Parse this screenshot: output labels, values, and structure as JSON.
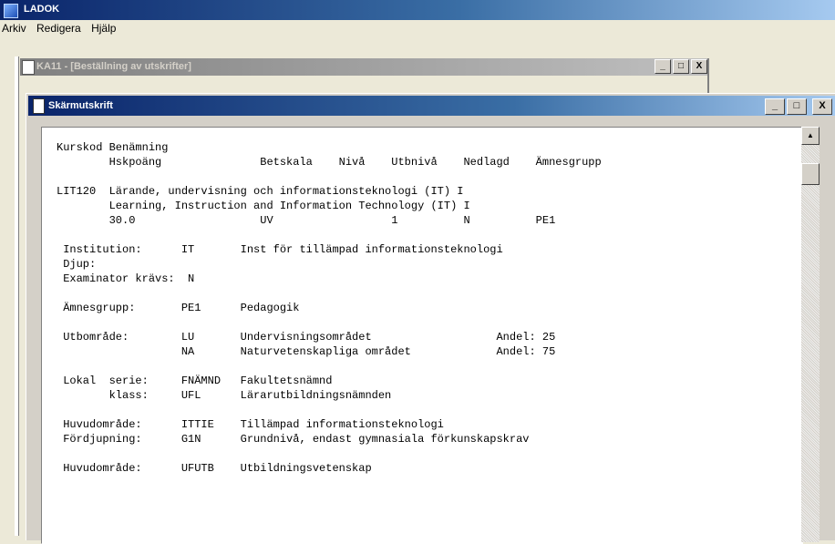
{
  "app": {
    "title": "LADOK"
  },
  "menu": [
    "Arkiv",
    "Redigera",
    "Hjälp"
  ],
  "background_window": {
    "title": "KA11 - [Beställning av utskrifter]"
  },
  "window": {
    "title": "Skärmutskrift",
    "controls": {
      "minimize": "_",
      "maximize": "□",
      "close": "X"
    }
  },
  "scrollbar": {
    "up_arrow": "▲"
  },
  "printout": {
    "lines": [
      "Kurskod Benämning",
      "        Hskpoäng               Betskala    Nivå    Utbnivå    Nedlagd    Ämnesgrupp",
      "",
      "LIT120  Lärande, undervisning och informationsteknologi (IT) I",
      "        Learning, Instruction and Information Technology (IT) I",
      "        30.0                   UV                  1          N          PE1",
      "",
      " Institution:      IT       Inst för tillämpad informationsteknologi",
      " Djup:",
      " Examinator krävs:  N",
      "",
      " Ämnesgrupp:       PE1      Pedagogik",
      "",
      " Utbområde:        LU       Undervisningsområdet                   Andel: 25",
      "                   NA       Naturvetenskapliga området             Andel: 75",
      "",
      " Lokal  serie:     FNÄMND   Fakultetsnämnd",
      "        klass:     UFL      Lärarutbildningsnämnden",
      "",
      " Huvudområde:      ITTIE    Tillämpad informationsteknologi",
      " Fördjupning:      G1N      Grundnivå, endast gymnasiala förkunskapskrav",
      "",
      " Huvudområde:      UFUTB    Utbildningsvetenskap"
    ]
  }
}
